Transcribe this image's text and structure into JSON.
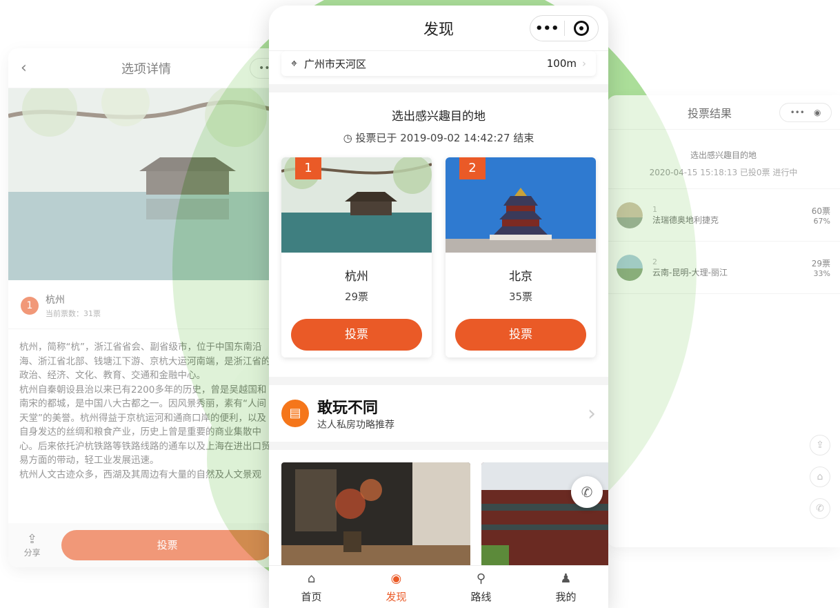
{
  "left": {
    "title": "选项详情",
    "back_icon": "‹",
    "option_number": "1",
    "option_name": "杭州",
    "option_votes": "当前票数：31票",
    "description": "杭州，简称“杭”，浙江省省会、副省级市，位于中国东南沿海、浙江省北部、钱塘江下游、京杭大运河南端，是浙江省的政治、经济、文化、教育、交通和金融中心。\n杭州自秦朝设县治以来已有2200多年的历史，曾是吴越国和南宋的都城，是中国八大古都之一。因风景秀丽，素有“人间天堂”的美誉。杭州得益于京杭运河和通商口岸的便利，以及自身发达的丝绸和粮食产业，历史上曾是重要的商业集散中心。后来依托沪杭铁路等铁路线路的通车以及上海在进出口贸易方面的带动，轻工业发展迅速。\n杭州人文古迹众多，西湖及其周边有大量的自然及人文景观",
    "share_label": "分享",
    "vote_label": "投票"
  },
  "center": {
    "title": "发现",
    "capsule_dots": "•••",
    "location": {
      "address": "广州市天河区",
      "distance": "100m"
    },
    "vote": {
      "title": "选出感兴趣目的地",
      "time": "投票已于 2019-09-02 14:42:27 结束",
      "options": [
        {
          "num": "1",
          "name": "杭州",
          "votes": "29票",
          "button": "投票"
        },
        {
          "num": "2",
          "name": "北京",
          "votes": "35票",
          "button": "投票"
        }
      ]
    },
    "promo": {
      "title": "敢玩不同",
      "subtitle": "达人私房功略推荐"
    },
    "tabs": [
      {
        "label": "首页",
        "icon": "home-icon"
      },
      {
        "label": "发现",
        "icon": "eye-icon"
      },
      {
        "label": "路线",
        "icon": "pin-icon"
      },
      {
        "label": "我的",
        "icon": "user-icon"
      }
    ]
  },
  "right": {
    "title": "投票结果",
    "head_title": "选出感兴趣目的地",
    "head_meta": "2020-04-15 15:18:13  已投0票  进行中",
    "rows": [
      {
        "num": "1",
        "name": "法瑞德奥地利捷克",
        "votes": "60票",
        "pct": "67%"
      },
      {
        "num": "2",
        "name": "云南-昆明-大理-丽江",
        "votes": "29票",
        "pct": "33%"
      }
    ]
  },
  "colors": {
    "accent": "#ea5a27",
    "green": "#a7dc93"
  }
}
